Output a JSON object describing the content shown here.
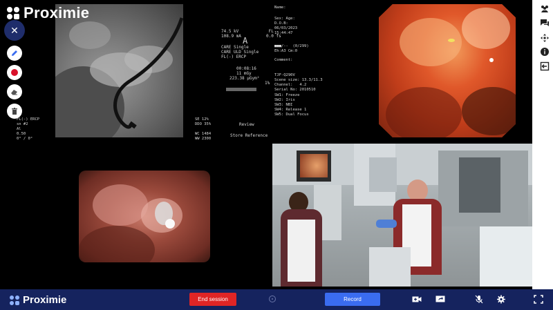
{
  "brand": {
    "name": "Proximie"
  },
  "fluoro_overlay": {
    "top_left": "FL(-) ERCP\nsn #2\nAl\n0.50\n0° / 0°",
    "bottom_right": "SE 12%\nDDO 35%\n\nWC 1484\nWW 2300"
  },
  "xray_console": {
    "kv_line": "74.5 kV            FL",
    "ma_line": "108.9 mA          0.0 fs",
    "letter": "A",
    "mode1": "CARE Single",
    "mode2": "CARE ULD Single",
    "mode3": "FL(-) ERCP",
    "time": "00:08:16",
    "mgy": "11 mGy",
    "dose": "223.38 µGym²",
    "dose_pct": "1%",
    "review_label": "Review",
    "store_label": "Store Reference"
  },
  "scope_info": {
    "name_label": "Name:",
    "patient": "Sex: Age:\nD.O.B:\n06/03/2023\n15:44:47",
    "ids": "■■■/--  (0/299)\nEh:A3 Cm:0",
    "comment_label": "Comment:",
    "scope": "TJF-Q290V\nScene size: 13.3/11.3\nChannel:   4.2\nSerial No: 2010510",
    "switches": "SW1: Freeze\nSW2: Iris\nSW3: NBI\nSW4: Release 1\nSW5: Dual Focus"
  },
  "toolbar": {
    "close_label": "✕",
    "tools": [
      "pen",
      "color",
      "eraser",
      "delete"
    ]
  },
  "bottom_bar": {
    "end_session_label": "End session",
    "record_label": "Record"
  },
  "colors": {
    "bottom_bar": "#15235e",
    "end_session": "#e02525",
    "record": "#3a6cf0",
    "annotation_color": "#d8102a"
  },
  "icons": {
    "right_bar": [
      "participants-icon",
      "chat-icon",
      "move-icon",
      "info-icon",
      "exit-icon"
    ],
    "bottom_bar": [
      "add-camera-icon",
      "screen-share-icon",
      "mic-off-icon",
      "settings-icon",
      "fullscreen-icon"
    ]
  }
}
